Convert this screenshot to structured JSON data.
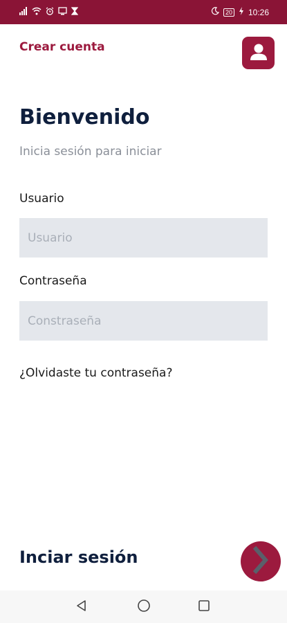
{
  "status_bar": {
    "left_icons": [
      "signal-icon",
      "wifi-icon",
      "alarm-icon",
      "cast-icon",
      "hourglass-icon"
    ],
    "right_icons": [
      "moon-icon",
      "battery-icon",
      "charging-icon"
    ],
    "battery": "20",
    "time": "10:26",
    "color": "#8a1436"
  },
  "header": {
    "create_account": "Crear cuenta",
    "profile_icon": "user-icon"
  },
  "welcome": {
    "title": "Bienvenido",
    "subtitle": "Inicia sesión para iniciar"
  },
  "form": {
    "user_label": "Usuario",
    "user_placeholder": "Usuario",
    "user_value": "",
    "password_label": "Contraseña",
    "password_placeholder": "Constraseña",
    "password_value": "",
    "forgot": "¿Olvidaste tu contraseña?"
  },
  "login": {
    "label": "Inciar sesión",
    "button_icon": "chevron-right-icon"
  },
  "nav": {
    "back_icon": "back-triangle-icon",
    "home_icon": "home-circle-icon",
    "recent_icon": "recent-square-icon"
  },
  "colors": {
    "accent": "#9c1a3e",
    "title": "#0f1f3d",
    "input_bg": "#e4e7ec"
  }
}
